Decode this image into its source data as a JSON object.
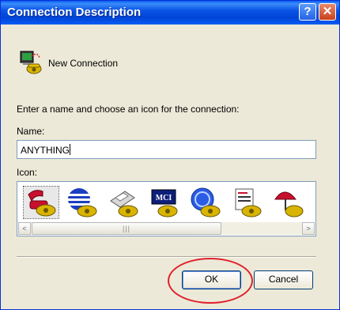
{
  "window": {
    "title": "Connection Description",
    "help_button": "?",
    "close_button": "✕"
  },
  "header": {
    "connection_label": "New Connection"
  },
  "instruction": "Enter a name and choose an icon for the connection:",
  "name_field": {
    "label": "Name:",
    "value": "ANYTHING"
  },
  "icon_field": {
    "label": "Icon:",
    "icons": [
      "red-phone-icon",
      "blue-globe-phone-icon",
      "fax-phone-icon",
      "mci-phone-icon",
      "ge-globe-phone-icon",
      "document-phone-icon",
      "umbrella-phone-icon"
    ],
    "scroll_left": "<",
    "scroll_right": ">",
    "thumb_grip": "|||"
  },
  "buttons": {
    "ok": "OK",
    "cancel": "Cancel"
  },
  "colors": {
    "titlebar": "#0a5cf5",
    "dialog_bg": "#ece9d8",
    "annotation": "#e0202a"
  }
}
